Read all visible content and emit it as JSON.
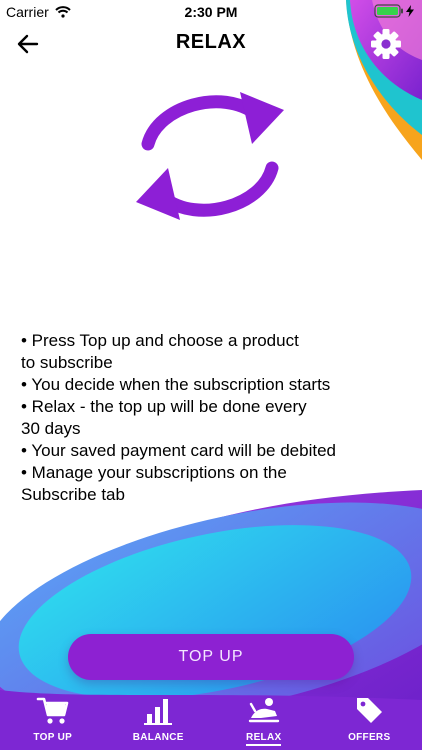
{
  "status_bar": {
    "carrier": "Carrier",
    "time": "2:30 PM"
  },
  "header": {
    "title": "RELAX"
  },
  "icons": {
    "back": "arrow-left-icon",
    "settings": "gear-icon",
    "main": "refresh-arrows-icon"
  },
  "bullets": [
    "• Press Top up and choose a product",
    "to subscribe",
    "• You decide when the subscription starts",
    "• Relax - the top up will be done every",
    "30 days",
    "• Your saved payment card will be debited",
    "• Manage your subscriptions on the",
    "Subscribe tab"
  ],
  "button": {
    "label": "TOP UP"
  },
  "tabs": [
    {
      "label": "TOP UP",
      "icon": "cart-icon",
      "active": false
    },
    {
      "label": "BALANCE",
      "icon": "bar-chart-icon",
      "active": false
    },
    {
      "label": "RELAX",
      "icon": "relax-icon",
      "active": true
    },
    {
      "label": "OFFERS",
      "icon": "tag-icon",
      "active": false
    }
  ],
  "colors": {
    "accent": "#8d21d2",
    "icon_purple": "#8d1fd6",
    "cyan": "#27c9ef",
    "orange": "#f7a41c"
  }
}
